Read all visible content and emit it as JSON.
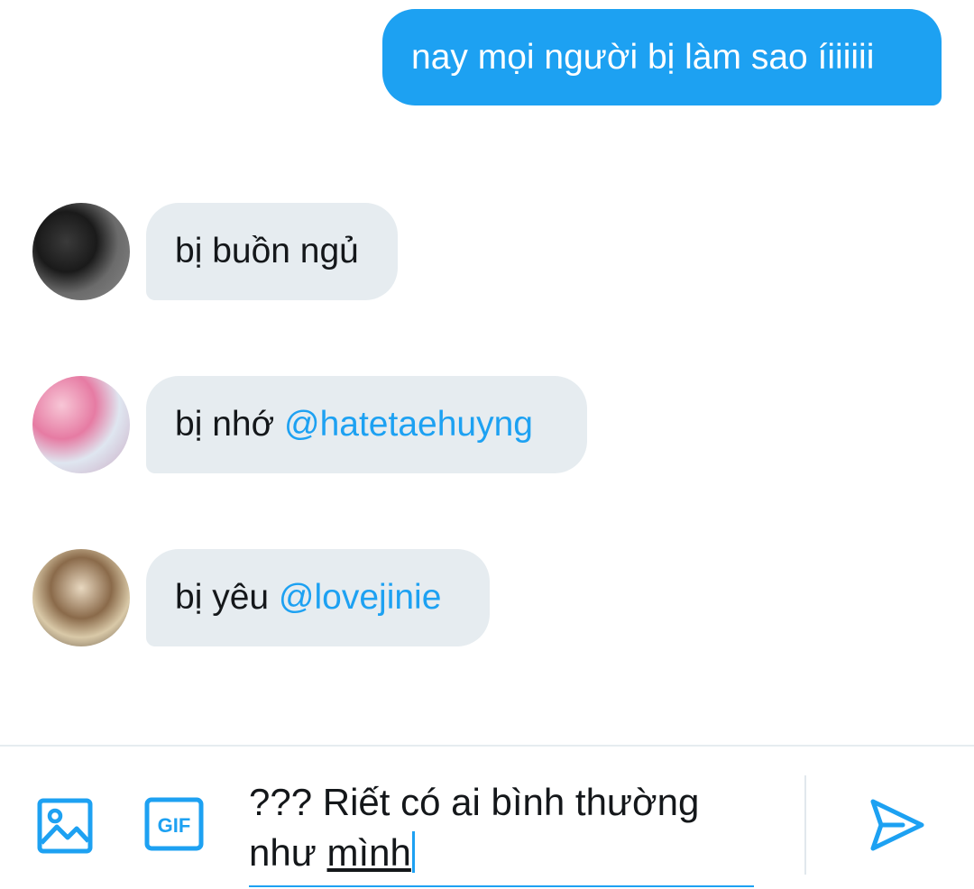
{
  "conversation": {
    "outgoing": [
      {
        "text": "nay mọi người bị làm sao íiiiiii"
      }
    ],
    "incoming": [
      {
        "text": "bị buồn ngủ",
        "mention": ""
      },
      {
        "text": "bị nhớ ",
        "mention": "@hatetaehuyng"
      },
      {
        "text": "bị yêu ",
        "mention": "@lovejinie"
      }
    ]
  },
  "composer": {
    "media_icon": "image-icon",
    "gif_label": "GIF",
    "send_icon": "send-icon",
    "draft_line1": "??? Riết có ai bình thường",
    "draft_line2_prefix": "như ",
    "draft_line2_word": "mình"
  },
  "colors": {
    "accent": "#1da1f2",
    "bubble_incoming": "#e6ecf0",
    "text": "#14171a"
  }
}
